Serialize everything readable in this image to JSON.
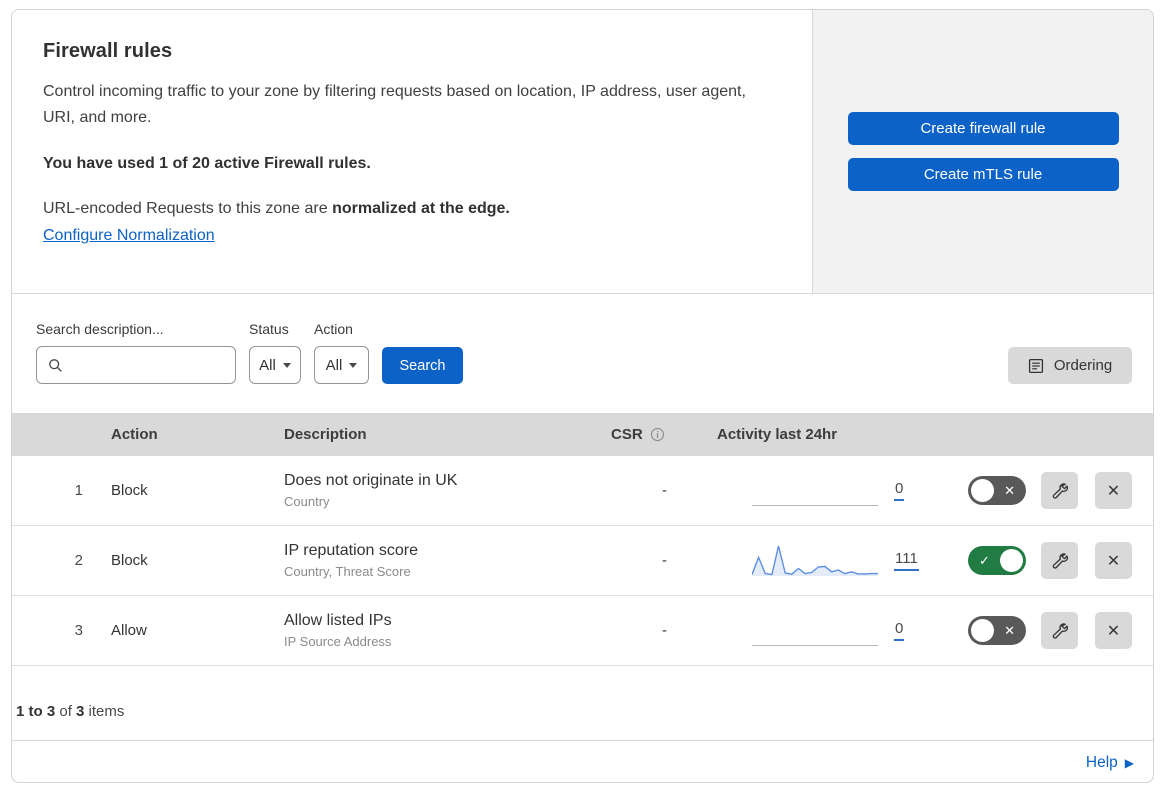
{
  "page": {
    "title": "Firewall rules",
    "description": "Control incoming traffic to your zone by filtering requests based on location, IP address, user agent, URI, and more.",
    "usage": "You have used 1 of 20 active Firewall rules.",
    "normalization_text": "URL-encoded Requests to this zone are ",
    "normalization_bold": "normalized at the edge.",
    "normalization_link": "Configure Normalization"
  },
  "actions_panel": {
    "create_firewall_rule": "Create firewall rule",
    "create_mtls_rule": "Create mTLS rule"
  },
  "filters": {
    "search_label": "Search description...",
    "search_value": "",
    "status_label": "Status",
    "status_value": "All",
    "action_label": "Action",
    "action_value": "All",
    "search_button": "Search",
    "ordering_button": "Ordering"
  },
  "table": {
    "headers": {
      "action": "Action",
      "description": "Description",
      "csr": "CSR",
      "activity": "Activity last 24hr"
    },
    "rows": [
      {
        "num": "1",
        "action": "Block",
        "description": "Does not originate in UK",
        "fields": "Country",
        "csr": "-",
        "activity_count": "0",
        "enabled": false,
        "sparkline": null
      },
      {
        "num": "2",
        "action": "Block",
        "description": "IP reputation score",
        "fields": "Country, Threat Score",
        "csr": "-",
        "activity_count": "111",
        "enabled": true,
        "sparkline": [
          5,
          62,
          8,
          5,
          100,
          10,
          6,
          25,
          8,
          12,
          30,
          32,
          14,
          20,
          8,
          14,
          7,
          7,
          8,
          8
        ]
      },
      {
        "num": "3",
        "action": "Allow",
        "description": "Allow listed IPs",
        "fields": "IP Source Address",
        "csr": "-",
        "activity_count": "0",
        "enabled": false,
        "sparkline": null
      }
    ]
  },
  "footer": {
    "range": "1 to 3",
    "of_text": " of ",
    "total": "3",
    "items_text": " items",
    "help_label": "Help"
  },
  "colors": {
    "accent_blue": "#0c62c6",
    "toggle_on_green": "#217c44",
    "toggle_off_gray": "#595959",
    "table_header_gray": "#d9d9d9",
    "panel_gray": "#f2f2f2",
    "sparkline_blue": "#5e8fe0"
  }
}
